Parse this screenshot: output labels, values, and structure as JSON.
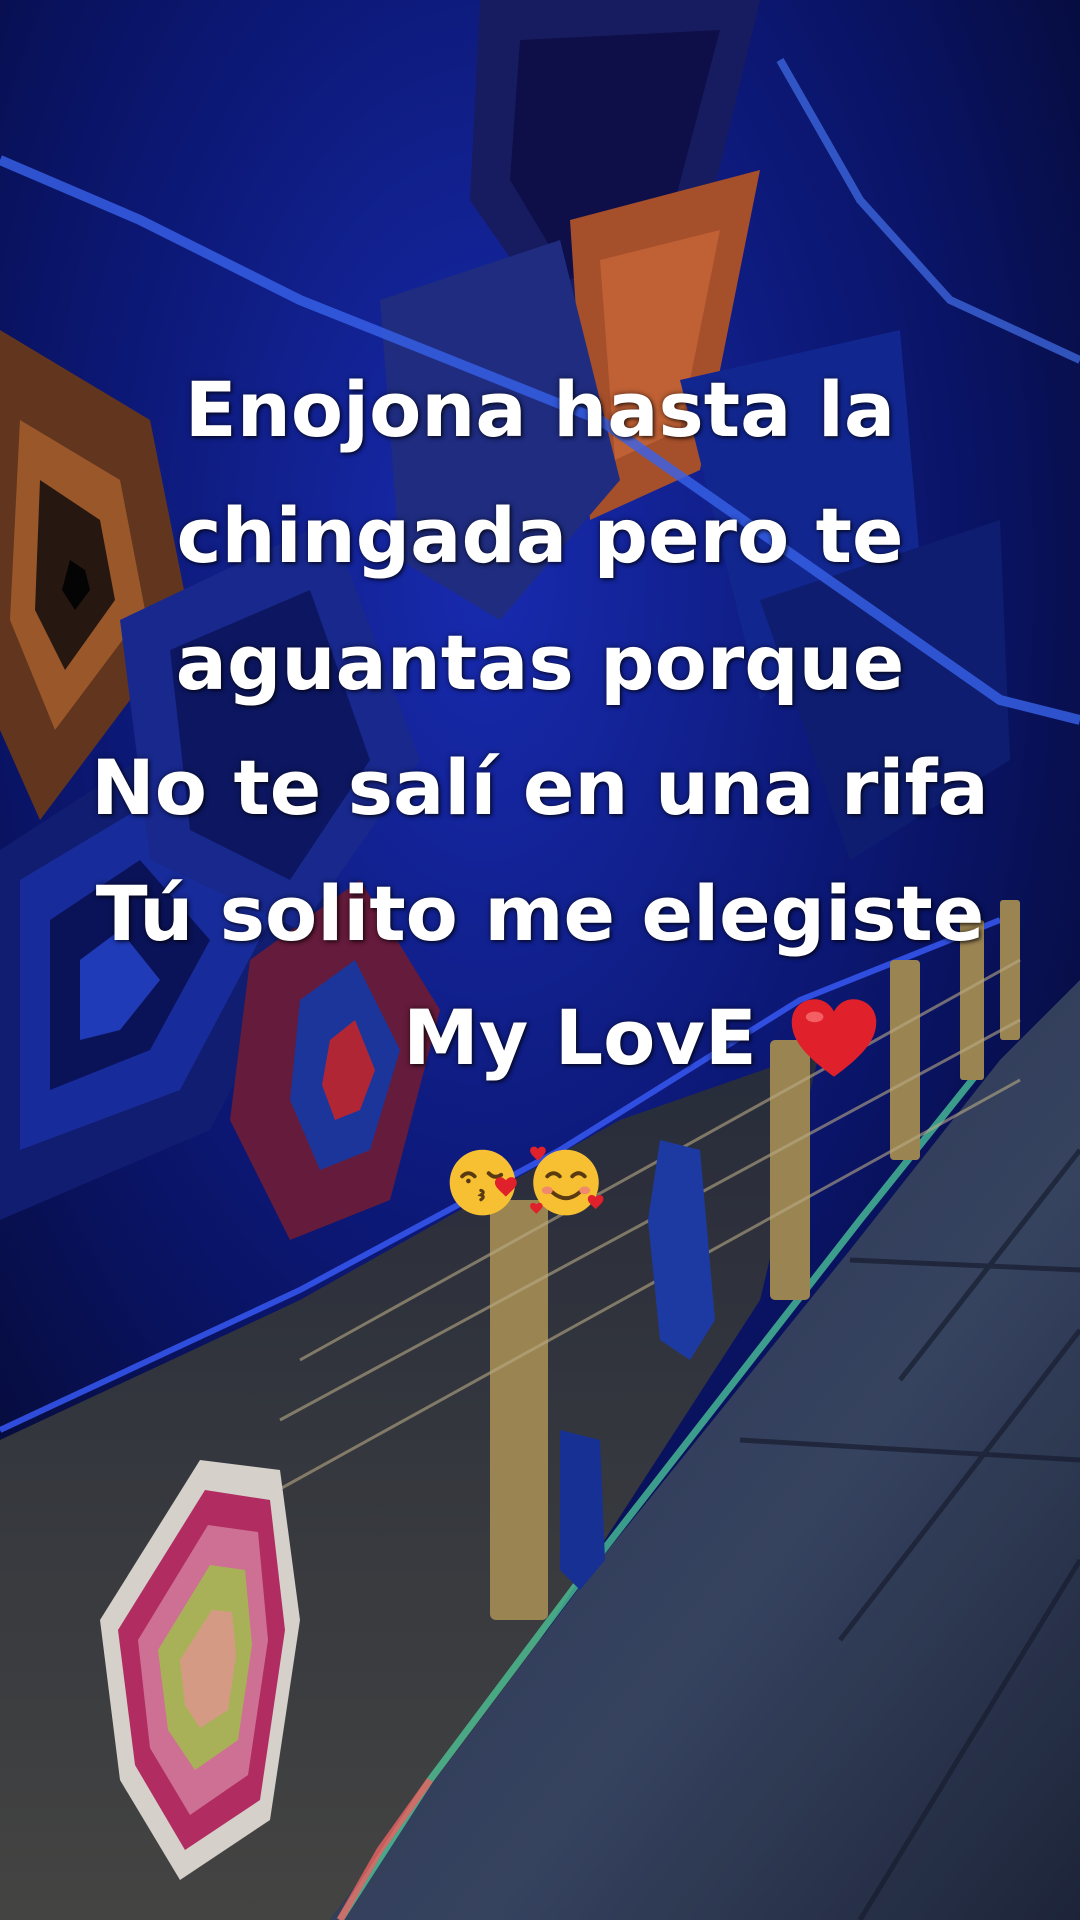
{
  "caption": {
    "lines": [
      "Enojona hasta la",
      "chingada pero te",
      "aguantas porque",
      "No te salí en una rifa",
      "Tú solito me elegiste",
      "My LovE"
    ],
    "heart_emoji": "red-heart",
    "trailing_emojis": [
      "face-blowing-a-kiss",
      "smiling-face-with-hearts"
    ]
  },
  "scene": {
    "description_icons": [
      "woven-diamond-wall-art",
      "fence-posts",
      "sidewalk",
      "neon-strip-lights"
    ],
    "colors": {
      "night_blue": "#0b1f8f",
      "neon_blue": "#2a5cff",
      "wall_orange": "#8a4a2a",
      "walkway_gray": "#3a4660",
      "text_white": "#ffffff",
      "heart_red": "#e0202a"
    }
  }
}
